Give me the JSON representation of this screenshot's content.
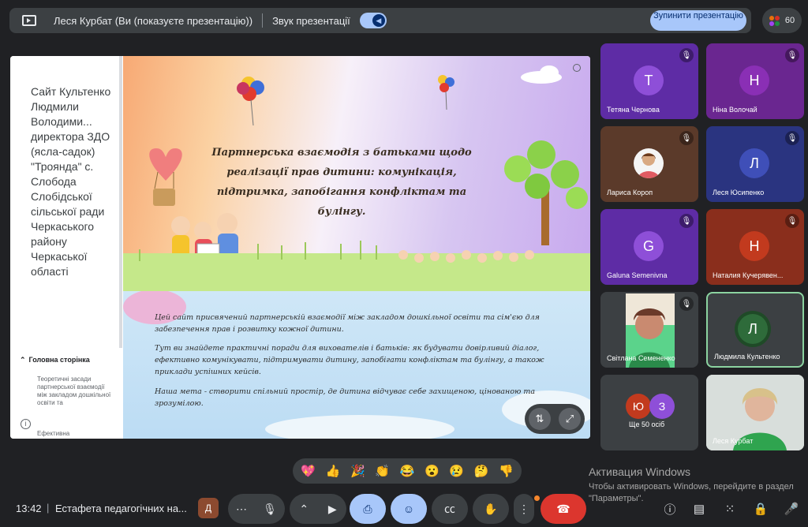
{
  "top_bar": {
    "presenter_name": "Леся Курбат (Ви (показуєте презентацію))",
    "sound_label": "Звук презентації",
    "stop_button": "Зупинити презентацію",
    "participant_count": "60"
  },
  "site": {
    "title": "Сайт Культенко Людмили Володими... директора ЗДО (ясла-садок) \"Троянда\" с. Слобода Слобідської сільської ради Черкаського району Черкаської області",
    "nav_home": "Головна сторінка",
    "nav_sub1": "Теоретичні засади партнерської взаємодії між закладом дошкільної освіти та",
    "nav_sub2": "Ефективна"
  },
  "slide": {
    "heading": "Партнерська взаємодія з батьками щодо реалізації прав дитини: комунікація, підтримка, запобігання конфліктам та булінгу.",
    "para1": "Цей сайт присвячений партнерській взаємодії між закладом дошкільної освіти та сім'єю для забезпечення прав і розвитку кожної дитини.",
    "para2": "Тут ви знайдете практичні поради для вихователів і батьків: як будувати довірливий діалог, ефективно комунікувати, підтримувати дитину, запобігати конфліктам та булінгу, а також приклади успішних кейсів.",
    "para3": "Наша мета - створити спільний простір, де дитина відчуває себе захищеною, цінованою та зрозумілою."
  },
  "participants": [
    {
      "name": "Тетяна Чернова",
      "initial": "Т",
      "avatar_color": "#8e4fd8"
    },
    {
      "name": "Ніна Волочай",
      "initial": "Н",
      "avatar_color": "#8a2fb5"
    },
    {
      "name": "Лариса Короп",
      "initial": "",
      "avatar_color": "#f5f5f5"
    },
    {
      "name": "Леся Юсипенко",
      "initial": "Л",
      "avatar_color": "#3f4fb8"
    },
    {
      "name": "Galuna Semenivna",
      "initial": "G",
      "avatar_color": "#8e4fd8"
    },
    {
      "name": "Наталия Кучерявен...",
      "initial": "Н",
      "avatar_color": "#c23a1e"
    },
    {
      "name": "Світлана Семененко",
      "initial": "",
      "avatar_color": "#7a5a45"
    },
    {
      "name": "Людмила Культенко",
      "initial": "Л",
      "avatar_color": "#2e6b3a"
    },
    {
      "name": "Леся Курбат",
      "initial": "",
      "avatar_color": "#8aa2a8"
    }
  ],
  "more_tile": {
    "label": "Ще 50 осіб",
    "bubble1": "Ю",
    "bubble2": "З"
  },
  "reactions": [
    "💖",
    "👍",
    "🎉",
    "👏",
    "😂",
    "😮",
    "😢",
    "🤔",
    "👎"
  ],
  "watermark": {
    "title": "Активация Windows",
    "text": "Чтобы активировать Windows, перейдите в раздел \"Параметры\"."
  },
  "bottom_bar": {
    "time": "13:42",
    "meeting_title": "Естафета педагогічних на...",
    "doc_letter": "Д"
  }
}
